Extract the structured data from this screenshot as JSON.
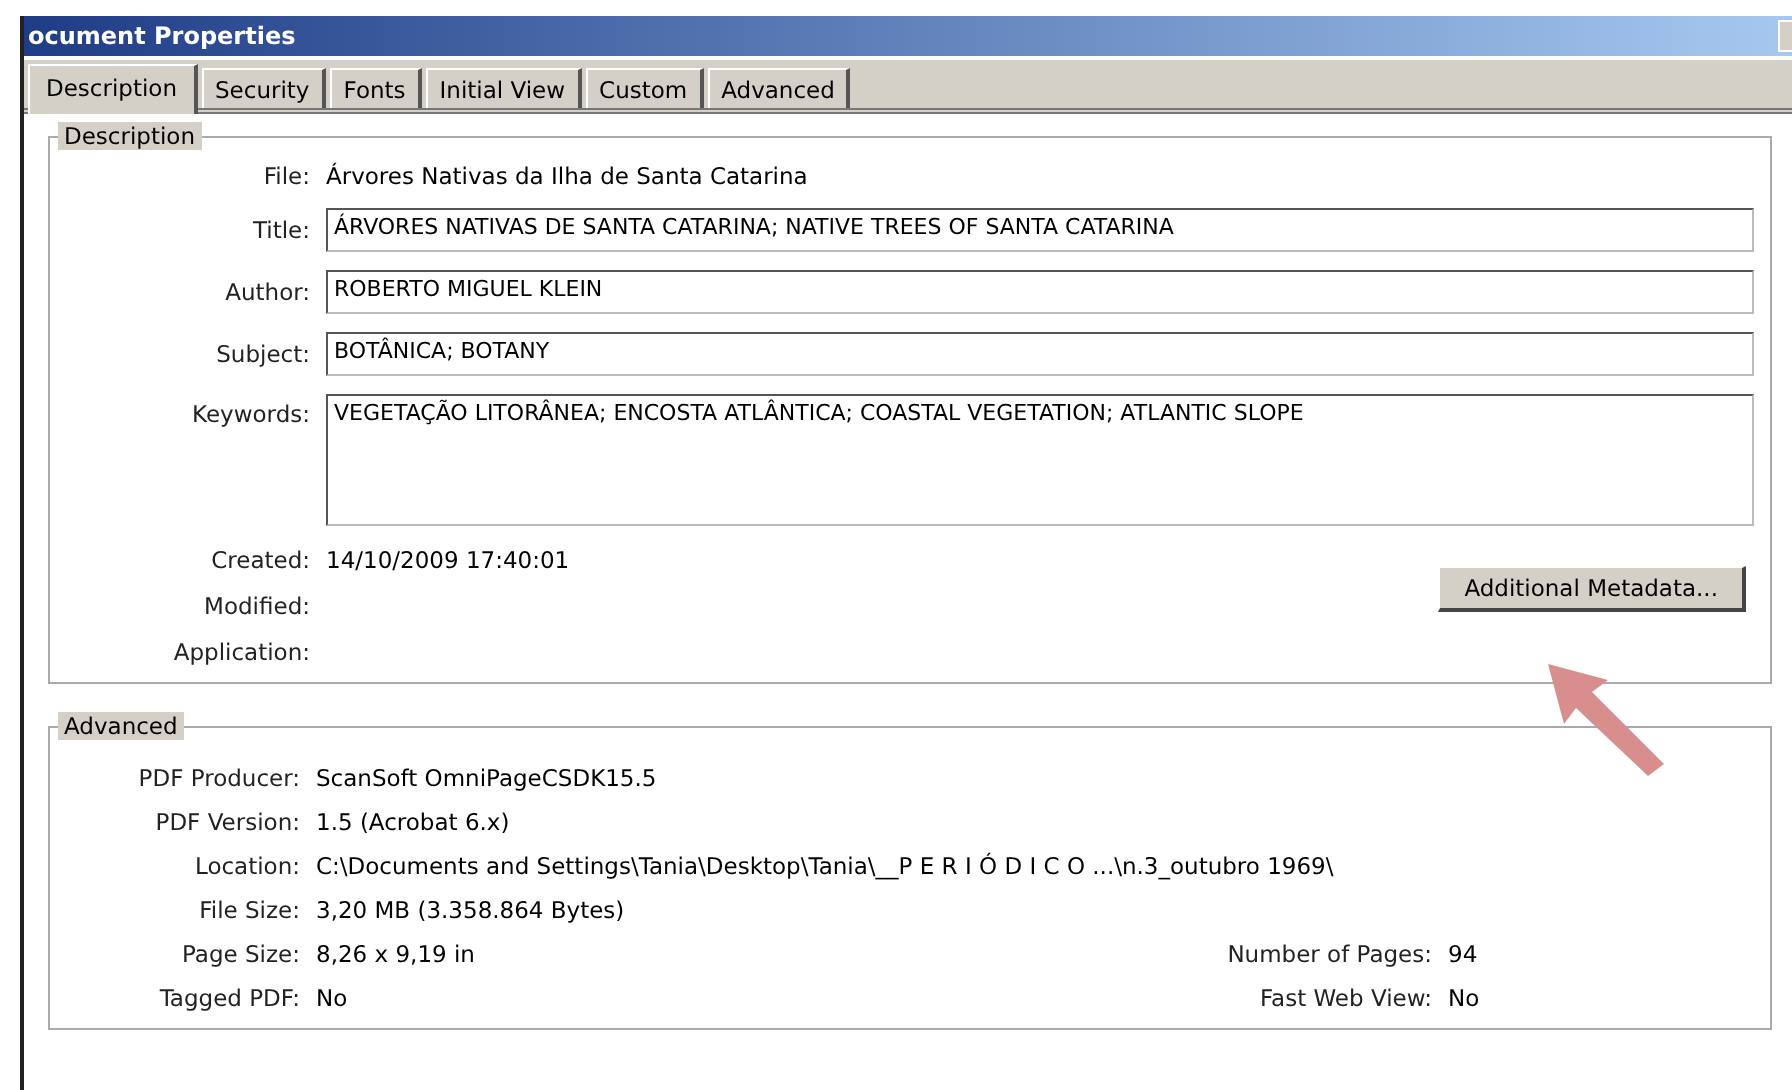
{
  "window": {
    "title": "ocument Properties"
  },
  "tabs": [
    {
      "label": "Description",
      "selected": true
    },
    {
      "label": "Security",
      "selected": false
    },
    {
      "label": "Fonts",
      "selected": false
    },
    {
      "label": "Initial View",
      "selected": false
    },
    {
      "label": "Custom",
      "selected": false
    },
    {
      "label": "Advanced",
      "selected": false
    }
  ],
  "description": {
    "legend": "Description",
    "file": {
      "label": "File:",
      "value": "Árvores Nativas da Ilha de Santa Catarina"
    },
    "fields": [
      {
        "label": "Title:",
        "value": "ÁRVORES NATIVAS DE SANTA CATARINA; NATIVE TREES OF SANTA CATARINA",
        "kind": "line"
      },
      {
        "label": "Author:",
        "value": "ROBERTO MIGUEL KLEIN",
        "kind": "line"
      },
      {
        "label": "Subject:",
        "value": "BOTÂNICA; BOTANY",
        "kind": "line"
      },
      {
        "label": "Keywords:",
        "value": "VEGETAÇÃO LITORÂNEA; ENCOSTA ATLÂNTICA; COASTAL VEGETATION; ATLANTIC SLOPE",
        "kind": "area"
      }
    ],
    "dates": [
      {
        "label": "Created:",
        "value": "14/10/2009 17:40:01"
      },
      {
        "label": "Modified:"
      },
      {
        "label": "Application:"
      }
    ],
    "button": "Additional Metadata..."
  },
  "advanced": {
    "legend": "Advanced",
    "rows": [
      {
        "label": "PDF Producer:",
        "value": "ScanSoft OmniPageCSDK15.5"
      },
      {
        "label": "PDF Version:",
        "value": "1.5 (Acrobat 6.x)"
      },
      {
        "label": "Location:",
        "value": "C:\\Documents and Settings\\Tania\\Desktop\\Tania\\__P E R I Ó D I C O ...\\n.3_outubro 1969\\"
      },
      {
        "label": "File Size:",
        "value": "3,20 MB (3.358.864 Bytes)"
      },
      {
        "label": "Page Size:",
        "value": "8,26 x 9,19 in",
        "label_2": "Number of Pages:",
        "value_2": "94"
      },
      {
        "label": "Tagged PDF:",
        "value": "No",
        "label_2": "Fast Web View:",
        "value_2": "No"
      }
    ]
  }
}
